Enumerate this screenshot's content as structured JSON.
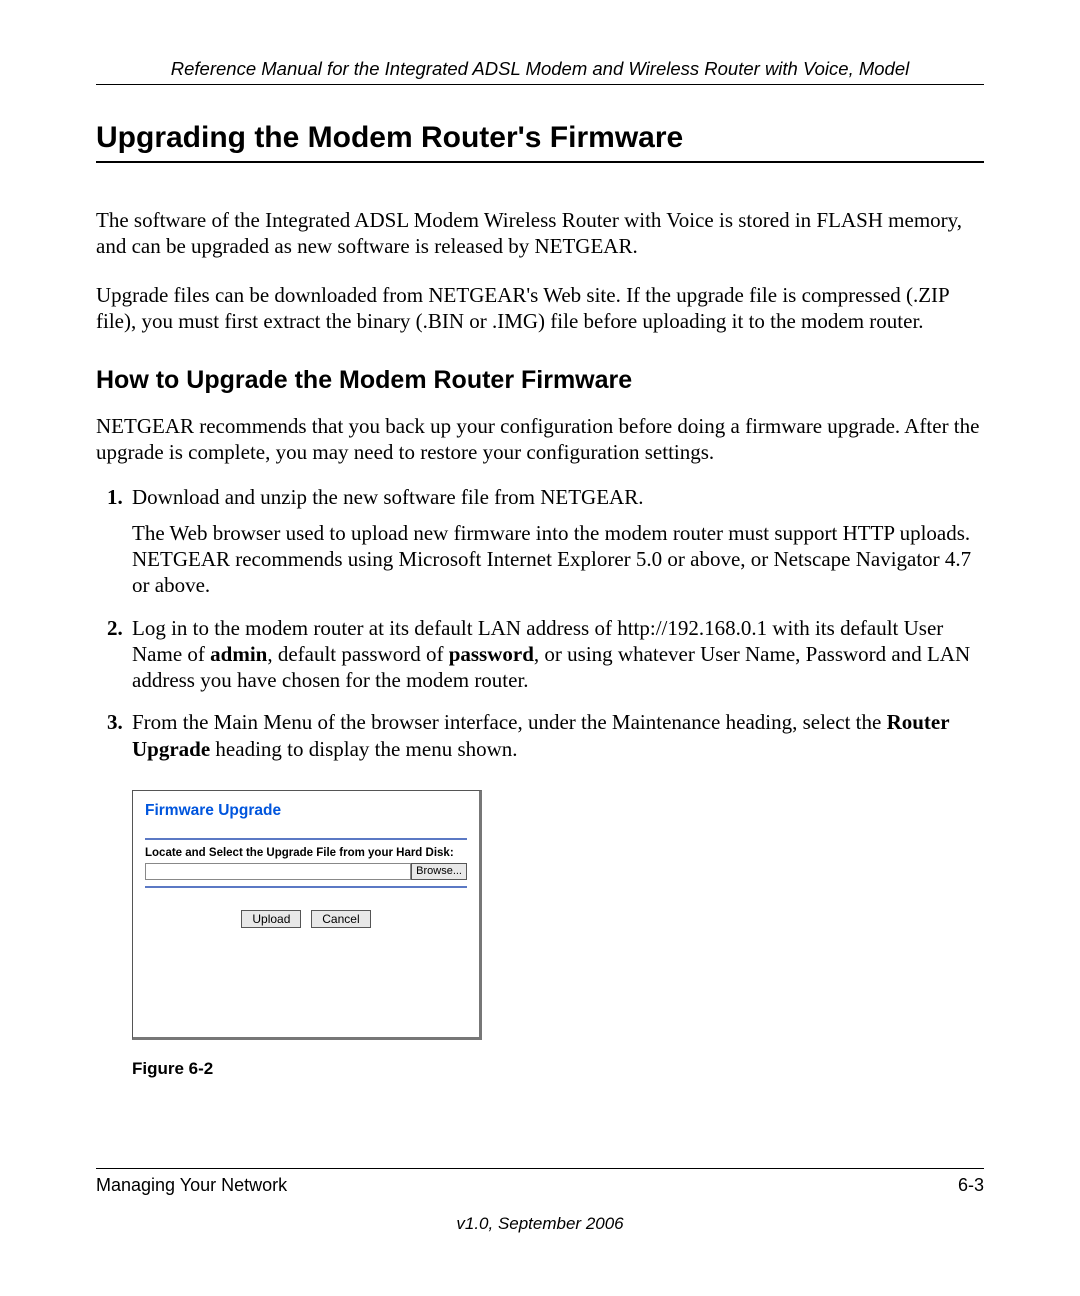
{
  "header": {
    "running_head": "Reference Manual for the Integrated ADSL Modem and Wireless Router with Voice, Model"
  },
  "section": {
    "title": "Upgrading the Modem Router's Firmware",
    "para1": "The software of the Integrated ADSL Modem Wireless Router with Voice is stored in FLASH memory, and can be upgraded as new software is released by NETGEAR.",
    "para2": "Upgrade files can be downloaded from NETGEAR's Web site. If the upgrade file is compressed (.ZIP file), you must first extract the binary (.BIN or .IMG) file before uploading it to the modem router."
  },
  "subsection": {
    "title": "How to Upgrade the Modem Router Firmware",
    "intro": "NETGEAR recommends that you back up your configuration before doing a firmware upgrade. After the upgrade is complete, you may need to restore your configuration settings.",
    "steps": {
      "s1_main": "Download and unzip the new software file from NETGEAR.",
      "s1_sub": "The Web browser used to upload new firmware into the modem router must support HTTP uploads. NETGEAR recommends using Microsoft Internet Explorer 5.0 or above, or Netscape Navigator 4.7 or above.",
      "s2_pre": "Log in to the modem router at its default LAN address of http://192.168.0.1 with its default User Name of ",
      "s2_admin": "admin",
      "s2_mid": ", default password of ",
      "s2_password": "password",
      "s2_post": ", or using whatever User Name, Password and LAN address you have chosen for the modem router.",
      "s3_pre": "From the Main Menu of the browser interface, under the Maintenance heading, select the ",
      "s3_bold": "Router Upgrade",
      "s3_post": " heading to display the menu shown."
    }
  },
  "firmware_panel": {
    "title": "Firmware Upgrade",
    "label": "Locate and Select the Upgrade File from your Hard Disk:",
    "browse": "Browse...",
    "upload": "Upload",
    "cancel": "Cancel"
  },
  "figure_caption": "Figure 6-2",
  "footer": {
    "left": "Managing Your Network",
    "right": "6-3",
    "version": "v1.0, September 2006"
  }
}
